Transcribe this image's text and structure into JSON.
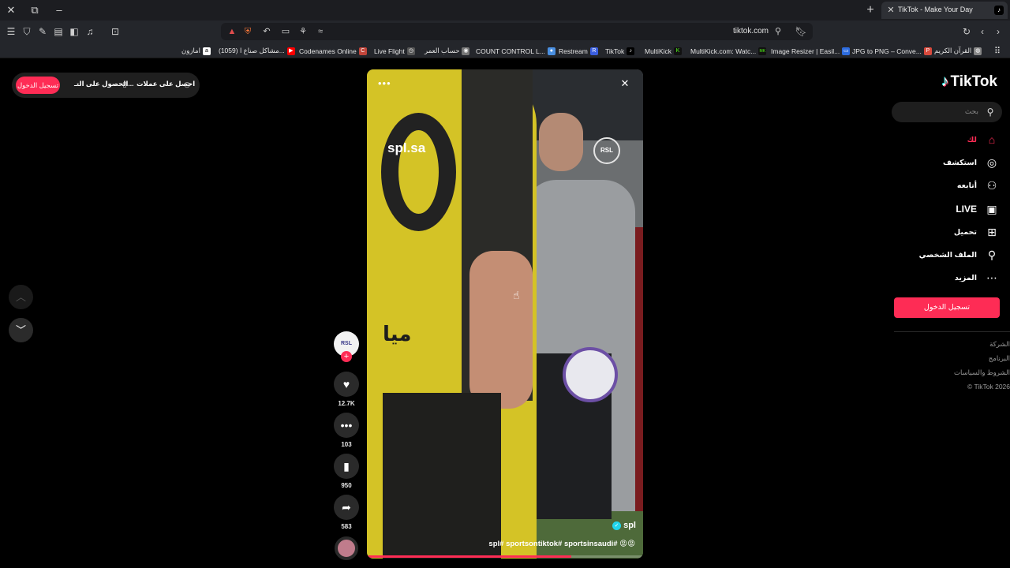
{
  "tabbar": {
    "close_window": "✕",
    "restore_window": "⧉",
    "minimize_window": "–",
    "new_tab": "+",
    "active_tab": {
      "title": "TikTok - Make Your Day",
      "close": "✕",
      "favicon": "♪"
    }
  },
  "toolbar": {
    "url": "tiktok.com",
    "left_icons": [
      "menu-icon",
      "shield-icon",
      "brush-icon",
      "tabs-icon",
      "sidebar-icon",
      "music-icon",
      "screenshot-icon"
    ],
    "right_icons": [
      "reload-icon",
      "back-icon",
      "forward-icon"
    ]
  },
  "bookmarks": [
    {
      "label": "امازون",
      "icon": "a",
      "color": "#ffffff"
    },
    {
      "label": "(1059) مشاكل صناع ا...",
      "icon": "▶",
      "color": "#ff0000"
    },
    {
      "label": "Codenames Online",
      "icon": "C",
      "color": "#c2453a"
    },
    {
      "label": "Live Flight",
      "icon": "◷",
      "color": "#555555"
    },
    {
      "label": "حساب العمر",
      "icon": "◉",
      "color": "#777777"
    },
    {
      "label": "COUNT CONTROL L...",
      "icon": "●",
      "color": "#4a90e2"
    },
    {
      "label": "Restream",
      "icon": "R",
      "color": "#3b5fe0"
    },
    {
      "label": "TikTok",
      "icon": "♪",
      "color": "#000000"
    },
    {
      "label": "MultiKick",
      "icon": "K",
      "color": "#1a1a1a"
    },
    {
      "label": "MultiKick.com: Watc...",
      "icon": "MK",
      "color": "#1a1a1a"
    },
    {
      "label": "Image Resizer | Easil...",
      "icon": "▭",
      "color": "#2d6cdf"
    },
    {
      "label": "JPG to PNG – Conve...",
      "icon": "P",
      "color": "#d94a3d"
    },
    {
      "label": "القرآن الكريم",
      "icon": "◍",
      "color": "#888888"
    }
  ],
  "promo": {
    "login": "تسجيل الدخول",
    "get_app": "الحصول على التـ...",
    "get_coins": "احصل على عملات"
  },
  "video": {
    "watermark": "spl.sa",
    "rsl_badge": "RSL",
    "more": "•••",
    "author": "spl",
    "verified": "✓",
    "caption": "spl# sportsontiktok# sportsinsaudi# 😡😡",
    "jersey_sponsor": "ميا",
    "progress_percent": 74
  },
  "actions": {
    "avatar_text": "RSL",
    "follow": "+",
    "like_count": "12.7K",
    "comment_count": "103",
    "bookmark_count": "950",
    "share_count": "583"
  },
  "sidebar": {
    "logo": "TikTok",
    "search_placeholder": "بحث",
    "nav": [
      {
        "label": "لك",
        "icon": "home-icon",
        "active": true
      },
      {
        "label": "استكشف",
        "icon": "compass-icon",
        "active": false
      },
      {
        "label": "أتابعه",
        "icon": "following-icon",
        "active": false
      },
      {
        "label": "LIVE",
        "icon": "live-icon",
        "active": false
      },
      {
        "label": "تحميل",
        "icon": "upload-icon",
        "active": false
      },
      {
        "label": "الملف الشخصي",
        "icon": "profile-icon",
        "active": false
      },
      {
        "label": "المزيد",
        "icon": "more-icon",
        "active": false
      }
    ],
    "login": "تسجيل الدخول",
    "footer": [
      "الشركة",
      "البرنامج",
      "الشروط والسياسات",
      "© TikTok 2026"
    ]
  },
  "colors": {
    "accent": "#fe2c55",
    "verified": "#20d5ec"
  }
}
